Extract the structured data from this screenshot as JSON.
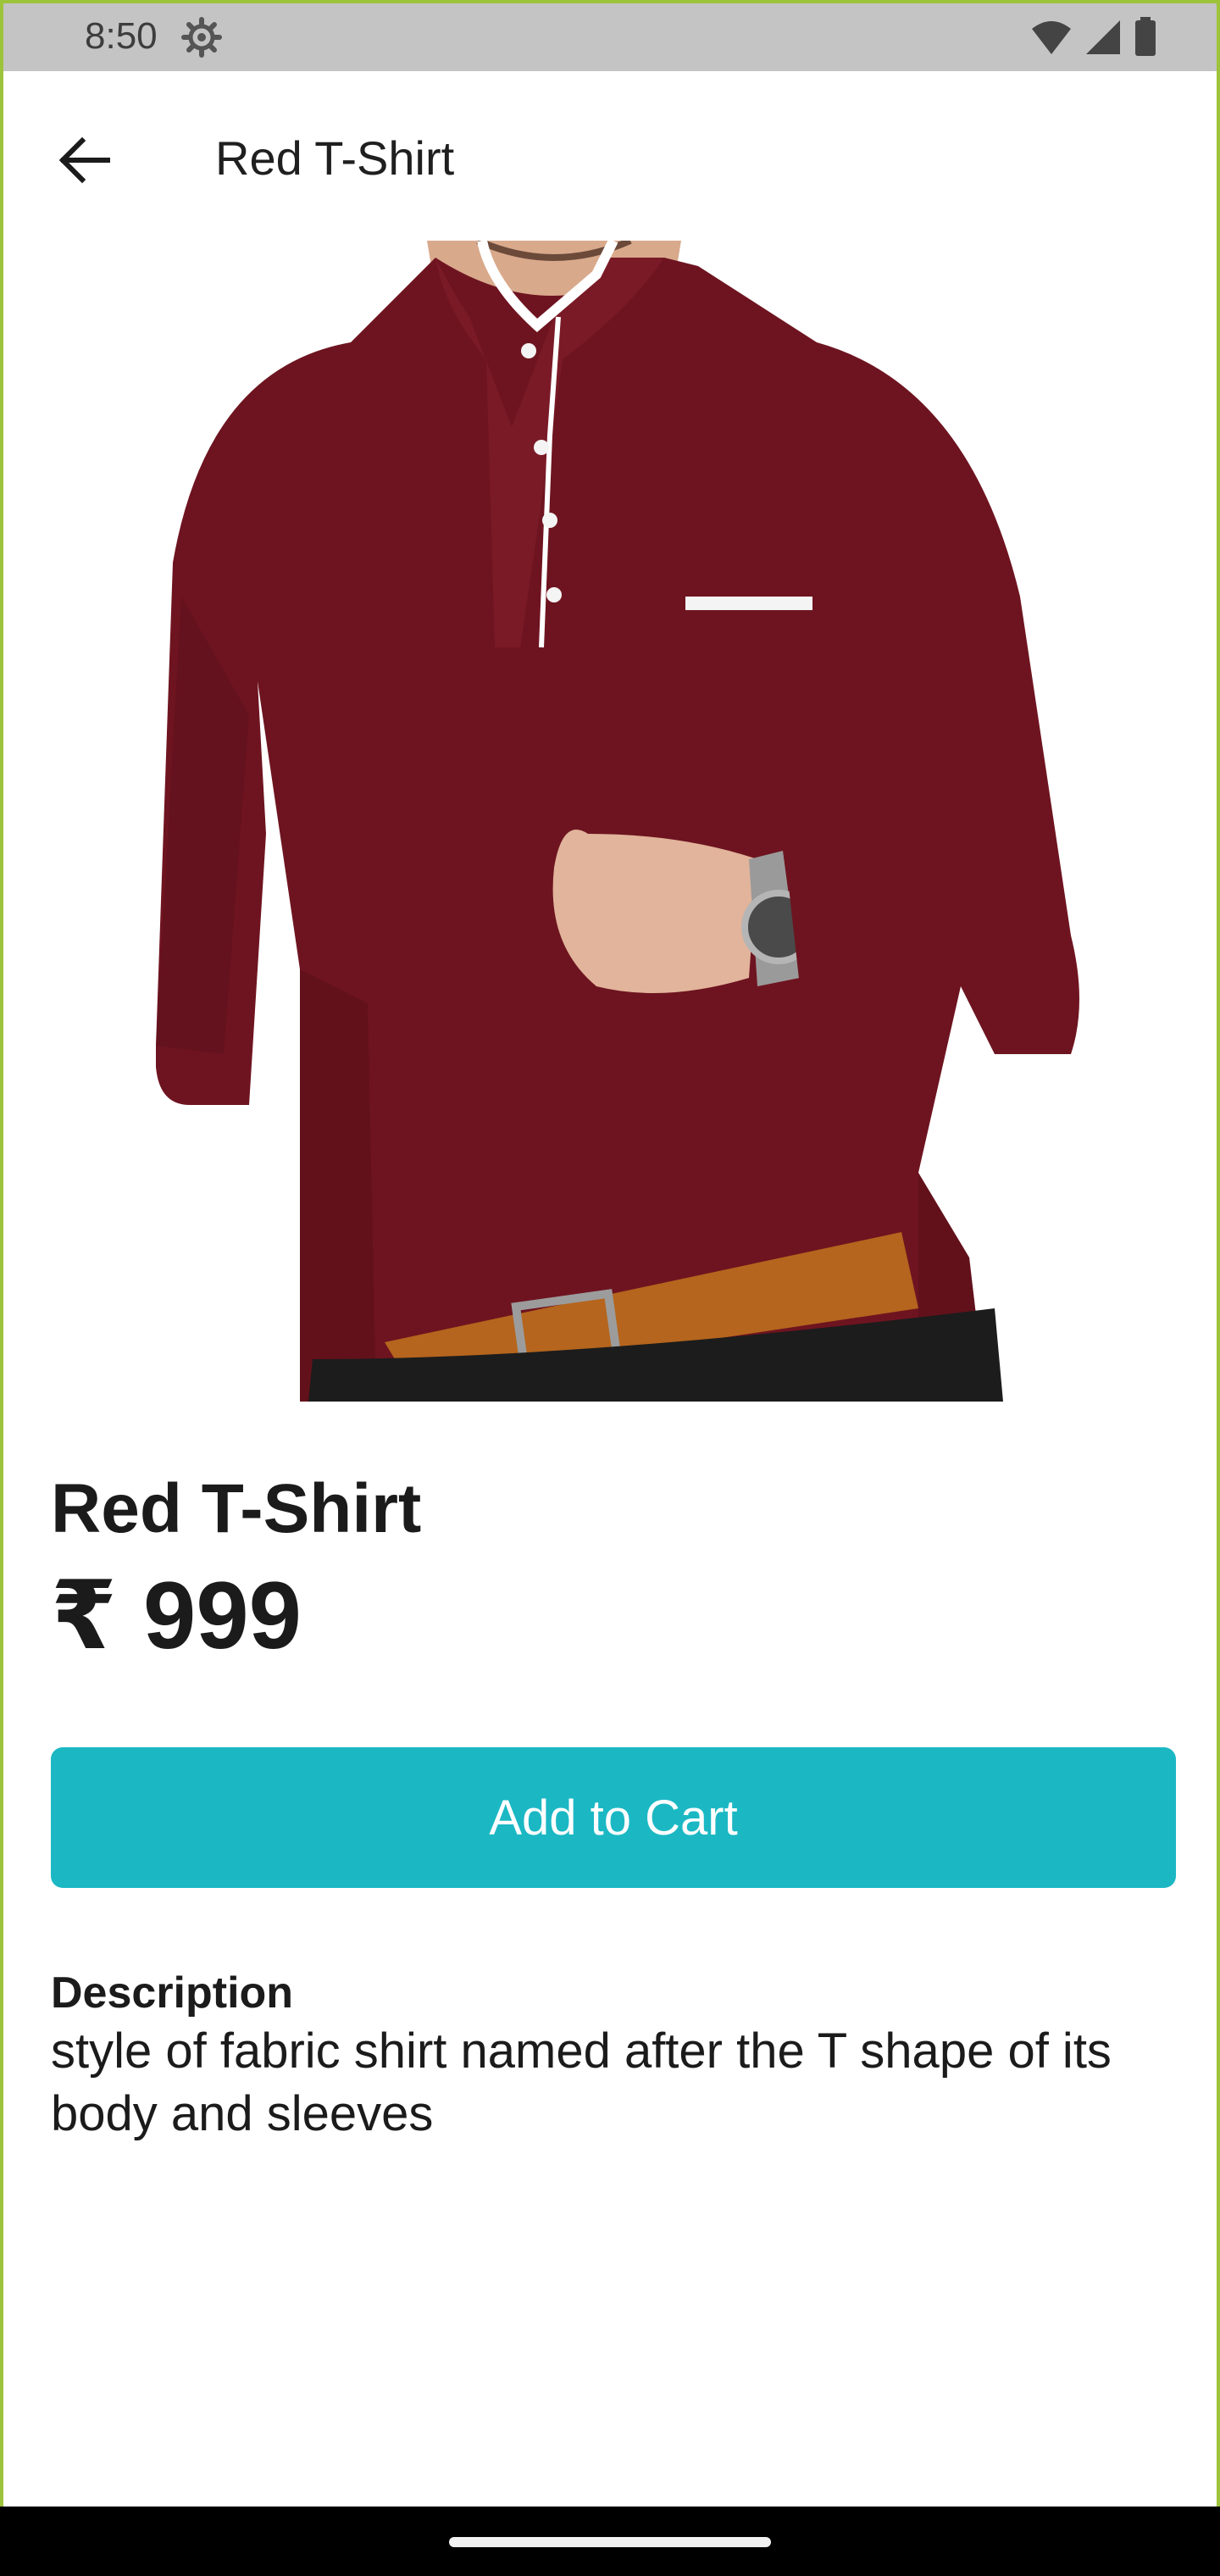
{
  "status_bar": {
    "time": "8:50",
    "icons": [
      "settings-gear-icon",
      "wifi-icon",
      "signal-icon",
      "battery-icon"
    ]
  },
  "app_bar": {
    "title": "Red T-Shirt",
    "back_icon": "arrow-left-icon"
  },
  "product": {
    "image_alt": "maroon-henley-shirt-photo",
    "name": "Red T-Shirt",
    "price": "₹ 999",
    "add_to_cart_label": "Add to Cart",
    "description_heading": "Description",
    "description": "style of fabric shirt named after the T shape of its body and sleeves"
  },
  "colors": {
    "accent": "#1bb8c4",
    "status_bar": "#c4c4c4",
    "shirt": "#6e1420",
    "frame": "#9dc33b"
  }
}
